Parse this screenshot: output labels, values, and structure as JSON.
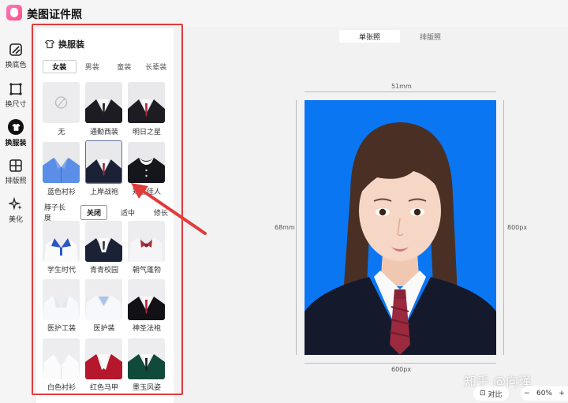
{
  "app": {
    "title": "美图证件照"
  },
  "sidebar": {
    "items": [
      {
        "label": "换底色",
        "icon": "background-icon"
      },
      {
        "label": "换尺寸",
        "icon": "crop-icon"
      },
      {
        "label": "换服装",
        "icon": "shirt-icon",
        "active": true
      },
      {
        "label": "排版照",
        "icon": "grid-icon"
      },
      {
        "label": "美化",
        "icon": "sparkle-icon"
      }
    ]
  },
  "panel": {
    "title": "换服装",
    "tabs": [
      "女装",
      "男装",
      "童装",
      "长辈装"
    ],
    "active_tab": "女装",
    "outfits_top": [
      {
        "label": "无"
      },
      {
        "label": "通勤西装"
      },
      {
        "label": "明日之星"
      },
      {
        "label": "蓝色衬衫"
      },
      {
        "label": "上岸战袍",
        "selected": true
      },
      {
        "label": "知性佳人"
      }
    ],
    "neck": {
      "label": "脖子长度",
      "options": [
        "关闭",
        "适中",
        "修长"
      ],
      "active": "关闭"
    },
    "outfits_bottom": [
      {
        "label": "学生时代"
      },
      {
        "label": "青青校园"
      },
      {
        "label": "朝气蓬勃"
      },
      {
        "label": "医护工装"
      },
      {
        "label": "医护装"
      },
      {
        "label": "神圣法袍"
      },
      {
        "label": "白色衬衫"
      },
      {
        "label": "红色马甲"
      },
      {
        "label": "墨玉风姿"
      }
    ]
  },
  "canvas": {
    "view_tabs": [
      "单张照",
      "排版照"
    ],
    "active_view": "单张照",
    "width_mm": "51mm",
    "height_mm": "68mm",
    "width_px": "600px",
    "height_px": "800px",
    "background_color": "#0b76f2"
  },
  "footer": {
    "watermark": "知乎 @向瑾",
    "compare_label": "对比",
    "zoom_minus": "−",
    "zoom_level": "60%",
    "zoom_plus": "+"
  },
  "colors": {
    "highlight": "#e23b3b",
    "accent_blue": "#0b76f2"
  }
}
